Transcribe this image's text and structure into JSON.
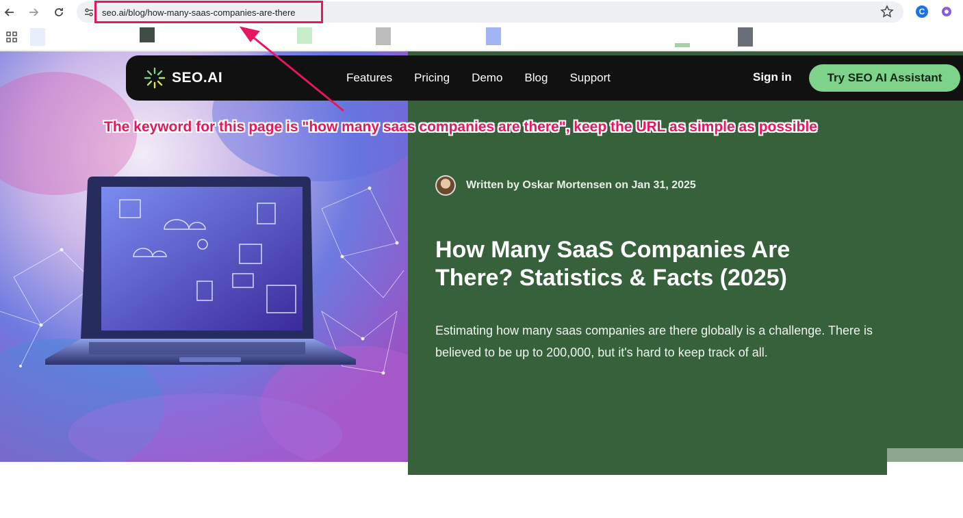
{
  "browser": {
    "url": "seo.ai/blog/how-many-saas-companies-are-there",
    "extension_letter": "C"
  },
  "site_nav": {
    "logo_text": "SEO.AI",
    "menu": [
      "Features",
      "Pricing",
      "Demo",
      "Blog",
      "Support"
    ],
    "sign_in": "Sign in",
    "cta": "Try SEO AI Assistant"
  },
  "annotation": {
    "text": "The keyword for this page is \"how many saas companies are there\", keep the URL as simple as possible",
    "color": "#e8175d"
  },
  "article": {
    "byline": "Written by Oskar Mortensen on Jan 31, 2025",
    "title": "How Many SaaS Companies Are There? Statistics & Facts (2025)",
    "intro": "Estimating how many saas companies are there globally is a challenge. There is believed to be up to 200,000, but it's hard to keep track of all."
  },
  "colors": {
    "panel_green": "#36613b",
    "cta_green": "#7ed38a",
    "nav_dark": "#111111"
  }
}
